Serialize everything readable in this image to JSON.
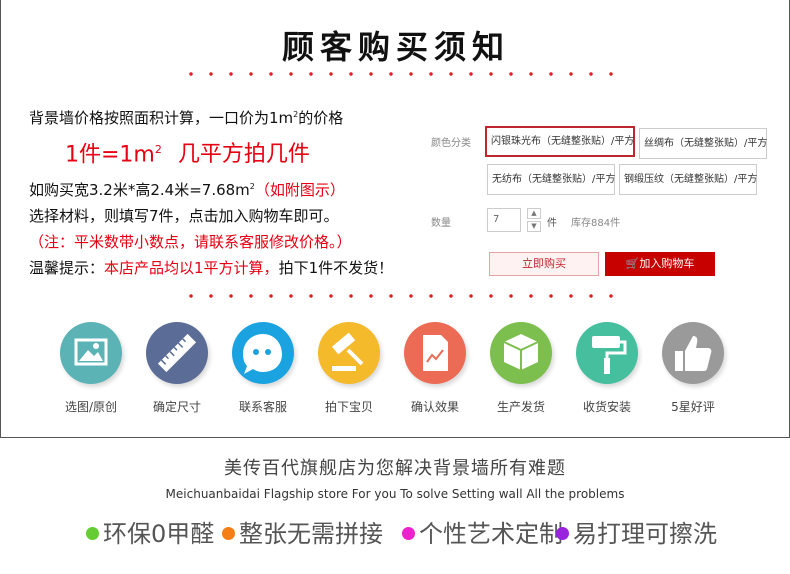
{
  "title": "顾客购买须知",
  "notice": {
    "line1_a": "背景墙价格按照面积计算，一口价为1m",
    "line1_sup": "2",
    "line1_b": "的价格",
    "big_a": "1件=1m",
    "big_sup": "2",
    "big_b": "几平方拍几件",
    "line3_a": "如购买宽3.2米*高2.4米=7.68m",
    "line3_sup": "2",
    "line3_b": "（如附图示）",
    "line4": "选择材料，则填写7件，点击加入购物车即可。",
    "line5": "（注：平米数带小数点，请联系客服修改价格。）",
    "line6_a": "温馨提示：",
    "line6_b": "本店产品均以1平方计算，",
    "line6_c": "拍下1件不发货！"
  },
  "sku": {
    "color_label": "颜色分类",
    "options": [
      "闪银珠光布（无缝整张贴）/平方",
      "丝绸布（无缝整张贴）/平方",
      "无纺布（无缝整张贴）/平方",
      "钢缎压纹（无缝整张贴）/平方"
    ],
    "qty_label": "数量",
    "qty_value": "7",
    "qty_unit": "件",
    "stock": "库存884件",
    "buy_now": "立即购买",
    "add_cart": "加入购物车"
  },
  "steps": [
    {
      "label": "选图/原创",
      "icon": "image-icon",
      "color": "#5bb3b5"
    },
    {
      "label": "确定尺寸",
      "icon": "ruler-icon",
      "color": "#5b6c97"
    },
    {
      "label": "联系客服",
      "icon": "chat-icon",
      "color": "#1aa3e0"
    },
    {
      "label": "拍下宝贝",
      "icon": "gavel-icon",
      "color": "#f5b92c"
    },
    {
      "label": "确认效果",
      "icon": "document-chart-icon",
      "color": "#ec6b55"
    },
    {
      "label": "生产发货",
      "icon": "box-icon",
      "color": "#7cbf4f"
    },
    {
      "label": "收货安装",
      "icon": "paint-roller-icon",
      "color": "#46bf9f"
    },
    {
      "label": "5星好评",
      "icon": "thumbs-up-icon",
      "color": "#9a9a9a"
    }
  ],
  "brand": "美传百代旗舰店为您解决背景墙所有难题",
  "brand_en": "Meichuanbaidai Flagship store For you To solve Setting wall All the problems",
  "features": [
    {
      "label": "环保0甲醛",
      "color": "#66cc33"
    },
    {
      "label": "整张无需拼接",
      "color": "#f57f17"
    },
    {
      "label": "个性艺术定制",
      "color": "#ee22cc"
    },
    {
      "label": "易打理可擦洗",
      "color": "#9922dd"
    }
  ]
}
